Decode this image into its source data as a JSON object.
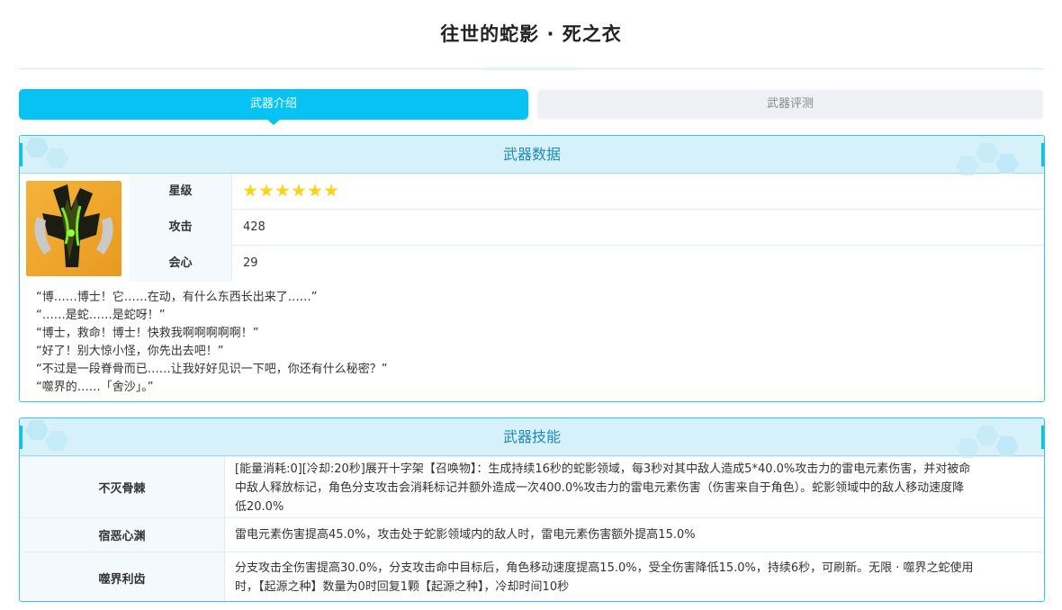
{
  "page": {
    "title": "往世的蛇影 · 死之衣"
  },
  "tabs": [
    {
      "label": "武器介绍",
      "active": true
    },
    {
      "label": "武器评测",
      "active": false
    }
  ],
  "weapon_data": {
    "heading": "武器数据",
    "image_alt": "weapon-icon",
    "rows": [
      {
        "label": "星级",
        "stars": 6
      },
      {
        "label": "攻击",
        "value": "428"
      },
      {
        "label": "会心",
        "value": "29"
      }
    ],
    "quotes": [
      "“博……博士！它……在动，有什么东西长出来了……”",
      "“……是蛇……是蛇呀！”",
      "“博士，救命！博士！快救我啊啊啊啊啊！”",
      "“好了！别大惊小怪，你先出去吧！”",
      "“不过是一段脊骨而已……让我好好见识一下吧，你还有什么秘密？”",
      "“噬界的……「舍沙」。”"
    ]
  },
  "weapon_skills": {
    "heading": "武器技能",
    "rows": [
      {
        "name": "不灭骨棘",
        "lines": [
          "[能量消耗:0][冷却:20秒]展开十字架【召唤物】：生成持续16秒的蛇影领域，每3秒对其中敌人造成5*40.0%攻击力的雷电元素伤害，并对被命",
          "中敌人释放标记，角色分支攻击会消耗标记并额外造成一次400.0%攻击力的雷电元素伤害（伤害来自于角色）。蛇影领域中的敌人移动速度降",
          "低20.0%"
        ]
      },
      {
        "name": "宿恶心渊",
        "lines": [
          "雷电元素伤害提高45.0%，攻击处于蛇影领域内的敌人时，雷电元素伤害额外提高15.0%"
        ]
      },
      {
        "name": "噬界利齿",
        "lines": [
          "分支攻击全伤害提高30.0%，分支攻击命中目标后，角色移动速度提高15.0%，受全伤害降低15.0%，持续6秒，可刷新。无限 · 噬界之蛇使用",
          "时，【起源之种】数量为0时回复1颗【起源之种】，冷却时间10秒"
        ]
      }
    ]
  },
  "colors": {
    "accent": "#06c3f4",
    "panel_head": "#d7f1fb",
    "heading_text": "#1e89b8",
    "star": "#ffd21a"
  }
}
